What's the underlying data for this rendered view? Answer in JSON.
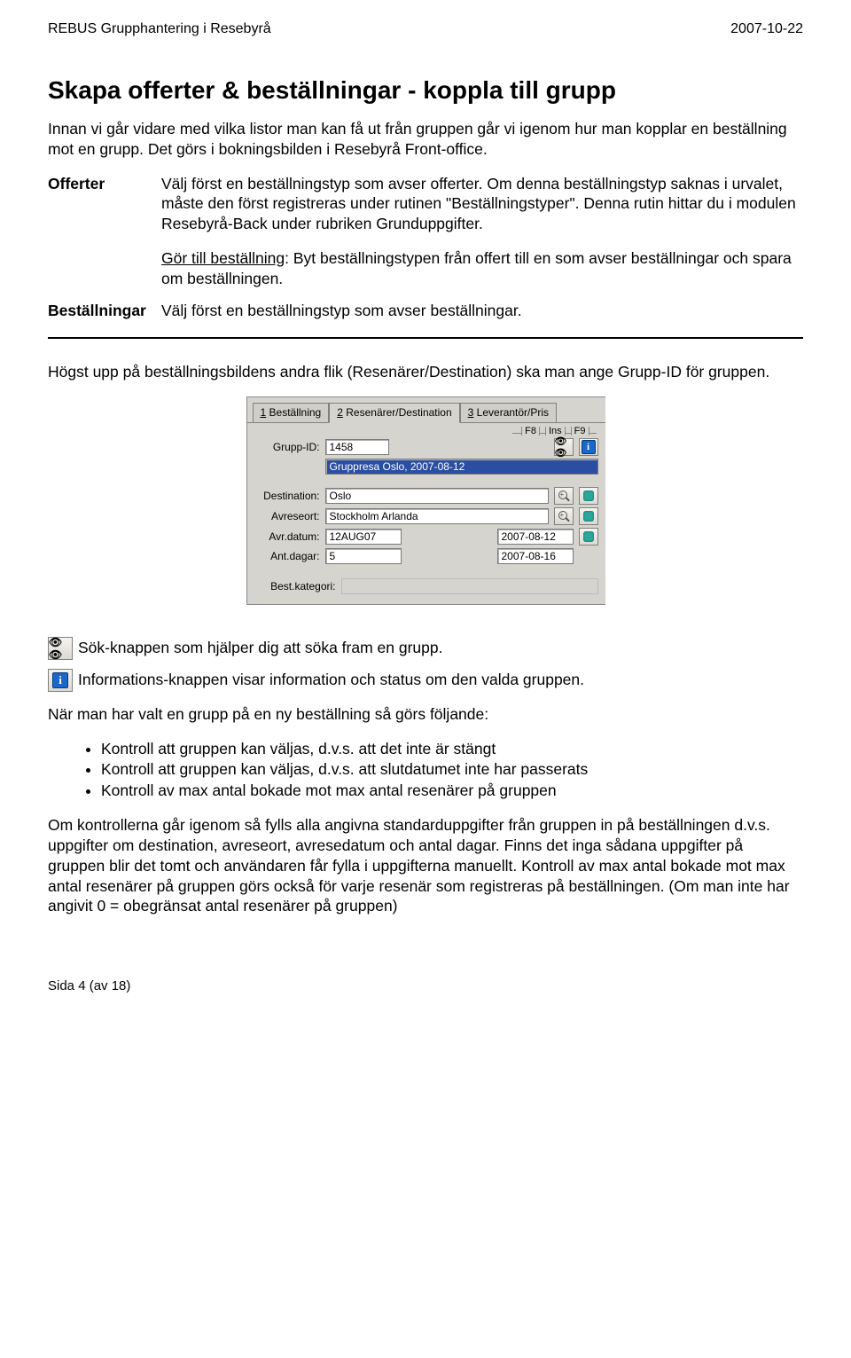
{
  "header": {
    "left": "REBUS Grupphantering i Resebyrå",
    "right": "2007-10-22"
  },
  "title": "Skapa offerter & beställningar - koppla till grupp",
  "intro": "Innan vi går vidare med vilka listor man kan få ut från gruppen går vi igenom hur man kopplar en beställning mot en grupp. Det görs i bokningsbilden i Resebyrå Front-office.",
  "defs": {
    "offerter": {
      "term": "Offerter",
      "body1": "Välj först en beställningstyp som avser offerter. Om denna beställningstyp saknas i urvalet, måste den först registreras under rutinen \"Beställningstyper\". Denna rutin hittar du i modulen Resebyrå-Back under rubriken Grunduppgifter.",
      "body2_pre": "Gör till beställning",
      "body2_post": ": Byt beställningstypen från offert till en som avser beställningar och spara om beställningen."
    },
    "bestallningar": {
      "term": "Beställningar",
      "body": "Välj först en beställningstyp som avser beställningar."
    }
  },
  "section2": {
    "para": "Högst upp på beställningsbildens andra flik (Resenärer/Destination) ska man ange Grupp-ID för gruppen."
  },
  "mock": {
    "tabs": {
      "t1_num": "1",
      "t1_label": " Beställning",
      "t2_num": "2",
      "t2_label": " Resenärer/Destination",
      "t3_num": "3",
      "t3_label": " Leverantör/Pris"
    },
    "hints": {
      "f8": "F8",
      "ins": "Ins",
      "f9": "F9"
    },
    "fields": {
      "gruppid_label": "Grupp-ID:",
      "gruppid_value": "1458",
      "gruppname": "Gruppresa Oslo, 2007-08-12",
      "dest_label": "Destination:",
      "dest_value": "Oslo",
      "avreseort_label": "Avreseort:",
      "avreseort_value": "Stockholm Arlanda",
      "avrdatum_label": "Avr.datum:",
      "avrdatum_value": "12AUG07",
      "avrdatum_iso": "2007-08-12",
      "antdagar_label": "Ant.dagar:",
      "antdagar_value": "5",
      "slutdatum": "2007-08-16",
      "bestkat_label": "Best.kategori:"
    }
  },
  "iconlines": {
    "search": "Sök-knappen som hjälper dig att söka fram en grupp.",
    "info": "Informations-knappen visar information och status om den valda gruppen."
  },
  "afterIcons": "När man har valt en grupp på en ny beställning så görs följande:",
  "bullets": {
    "b1": "Kontroll att gruppen kan väljas, d.v.s. att det inte är stängt",
    "b2": "Kontroll att gruppen kan väljas, d.v.s. att slutdatumet inte har passerats",
    "b3": "Kontroll av max antal bokade mot max antal resenärer på gruppen"
  },
  "finalPara": "Om kontrollerna går igenom så fylls alla angivna standarduppgifter från gruppen in på beställningen d.v.s. uppgifter om destination, avreseort, avresedatum och antal dagar. Finns det inga sådana uppgifter på gruppen blir det tomt och användaren får fylla i uppgifterna manuellt. Kontroll av max antal bokade mot max antal resenärer på gruppen görs också för varje resenär som registreras på beställningen. (Om man inte har angivit 0 = obegränsat antal resenärer på gruppen)",
  "footer": "Sida 4  (av 18)"
}
